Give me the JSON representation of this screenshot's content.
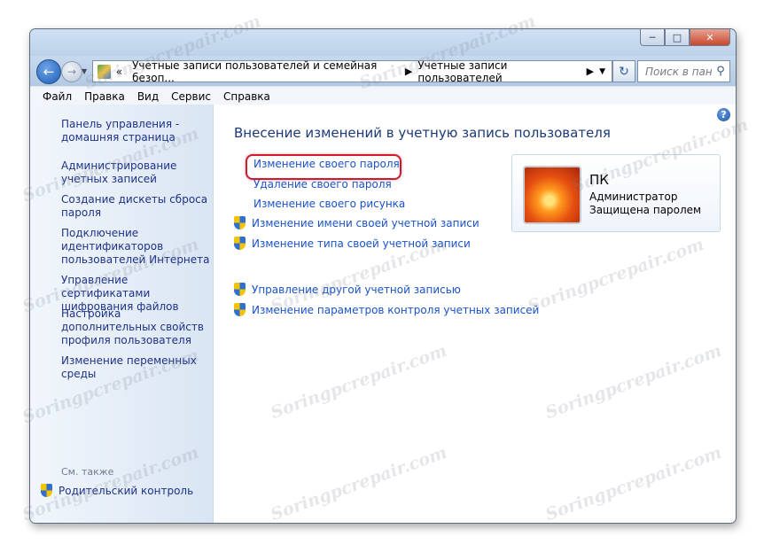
{
  "window": {
    "caption_buttons": {
      "minimize": "─",
      "maximize": "□",
      "close": "✕"
    }
  },
  "nav": {
    "breadcrumb": [
      "Учетные записи пользователей и семейная безоп...",
      "Учетные записи пользователей"
    ],
    "breadcrumb_prefix": "«",
    "search_placeholder": "Поиск в пан..."
  },
  "menu": [
    "Файл",
    "Правка",
    "Вид",
    "Сервис",
    "Справка"
  ],
  "sidebar": {
    "items": [
      "Панель управления - домашняя страница",
      "Администрирование учетных записей",
      "Создание дискеты сброса пароля",
      "Подключение идентификаторов пользователей Интернета",
      "Управление сертификатами шифрования файлов",
      "Настройка дополнительных свойств профиля пользователя",
      "Изменение переменных среды"
    ],
    "see_also": "См. также",
    "parental_control": "Родительский контроль"
  },
  "main": {
    "title": "Внесение изменений в учетную запись пользователя",
    "tasks": [
      "Изменение своего пароля",
      "Удаление своего пароля",
      "Изменение своего рисунка"
    ],
    "shield_tasks": [
      "Изменение имени своей учетной записи",
      "Изменение типа своей учетной записи"
    ],
    "other_tasks": [
      "Управление другой учетной записью",
      "Изменение параметров контроля учетных записей"
    ],
    "help": "?"
  },
  "account": {
    "name": "ПК",
    "role": "Администратор",
    "status": "Защищена паролем"
  },
  "watermark": "Soringpcrepair.com",
  "colors": {
    "link": "#1a53c9",
    "sidebar_link": "#1e3287",
    "title": "#1c3a78",
    "highlight": "#d0182e"
  }
}
